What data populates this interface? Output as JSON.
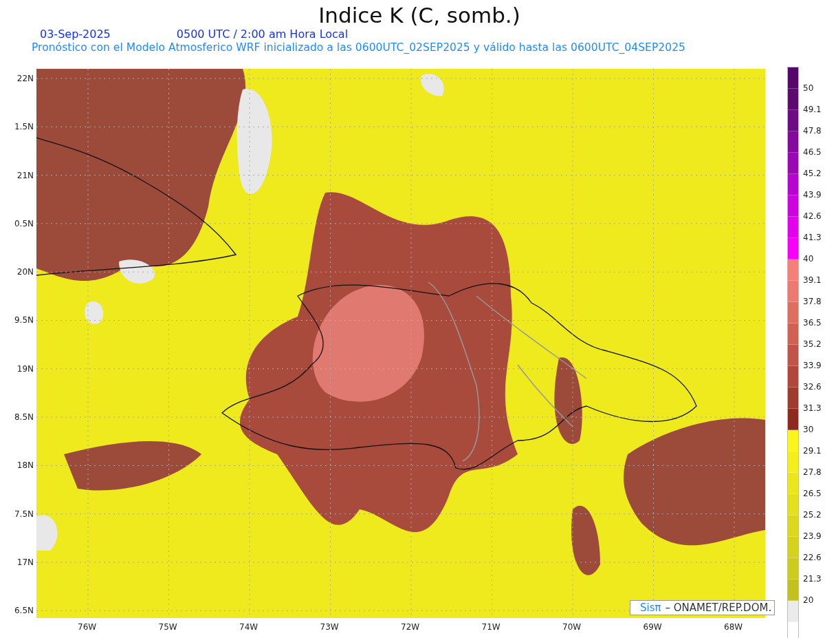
{
  "title": "Indice K (C, somb.)",
  "date": "03-Sep-2025",
  "time": "0500 UTC / 2:00 am Hora Local",
  "subtitle": "Pronóstico con el Modelo Atmosferico WRF inicializado a las 0600UTC_02SEP2025 y válido hasta las  0600UTC_04SEP2025",
  "y_ticks": [
    "22N",
    "1.5N",
    "21N",
    "0.5N",
    "20N",
    "9.5N",
    "19N",
    "8.5N",
    "18N",
    "7.5N",
    "17N",
    "6.5N"
  ],
  "x_ticks": [
    "76W",
    "75W",
    "74W",
    "73W",
    "72W",
    "71W",
    "70W",
    "69W",
    "68W"
  ],
  "legend": {
    "brand": "Sisπ",
    "text": "– ONAMET/REP.DOM."
  },
  "colorbar": {
    "bins": [
      {
        "color": "#55086a"
      },
      {
        "color": "#5c0a6e"
      },
      {
        "color": "#6f0a85"
      },
      {
        "color": "#830a9c"
      },
      {
        "color": "#9a08b4"
      },
      {
        "color": "#b406cc"
      },
      {
        "color": "#cc04de"
      },
      {
        "color": "#e202ec"
      },
      {
        "color": "#f800f8"
      },
      {
        "color": "#f5807a"
      },
      {
        "color": "#ec7a70"
      },
      {
        "color": "#de6e62"
      },
      {
        "color": "#cf6155"
      },
      {
        "color": "#c05449"
      },
      {
        "color": "#b0463c"
      },
      {
        "color": "#9f3a2f"
      },
      {
        "color": "#8c2c20"
      },
      {
        "color": "#fbf51c"
      },
      {
        "color": "#f4ee1c"
      },
      {
        "color": "#ebe61e"
      },
      {
        "color": "#e4e01e"
      },
      {
        "color": "#dcd81e"
      },
      {
        "color": "#d5d21e"
      },
      {
        "color": "#cdcb1e"
      },
      {
        "color": "#c3c11e"
      },
      {
        "color": "#ebebeb"
      }
    ],
    "labels": [
      "50",
      "49.1",
      "47.8",
      "46.5",
      "45.2",
      "43.9",
      "42.6",
      "41.3",
      "40",
      "39.1",
      "37.8",
      "36.5",
      "35.2",
      "33.9",
      "32.6",
      "31.3",
      "30",
      "29.1",
      "27.8",
      "26.5",
      "25.2",
      "23.9",
      "22.6",
      "21.3",
      "20"
    ]
  }
}
